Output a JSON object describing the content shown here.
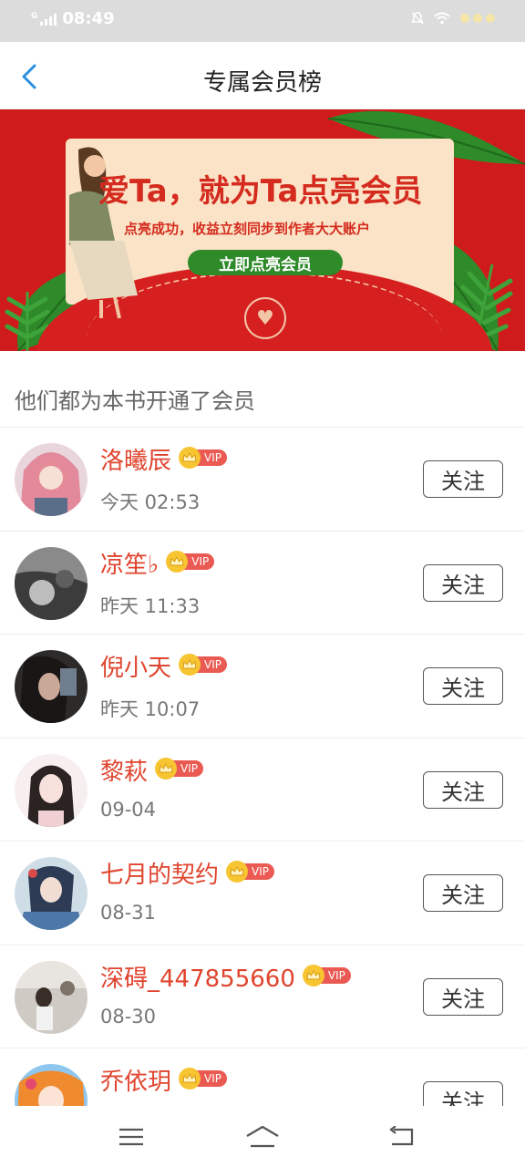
{
  "status_bar": {
    "time": "08:49",
    "network": "G"
  },
  "header": {
    "title": "专属会员榜"
  },
  "banner": {
    "headline": "爱Ta，就为Ta点亮会员",
    "subtitle": "点亮成功，收益立刻同步到作者大大账户",
    "cta_label": "立即点亮会员"
  },
  "section": {
    "title": "他们都为本书开通了会员"
  },
  "vip_label": "VIP",
  "follow_label": "关注",
  "members": [
    {
      "name": "洛曦辰",
      "time": "今天 02:53"
    },
    {
      "name": "凉笙♭",
      "time": "昨天 11:33"
    },
    {
      "name": "倪小天",
      "time": "昨天 10:07"
    },
    {
      "name": "黎萩",
      "time": "09-04"
    },
    {
      "name": "七月的契约",
      "time": "08-31"
    },
    {
      "name": "深碍_447855660",
      "time": "08-30"
    },
    {
      "name": "乔依玥",
      "time": ""
    }
  ],
  "colors": {
    "accent_name": "#e0442e",
    "banner_red": "#cf1b1b",
    "vip_red": "#ea5a52",
    "crown_gold": "#f7c531"
  }
}
